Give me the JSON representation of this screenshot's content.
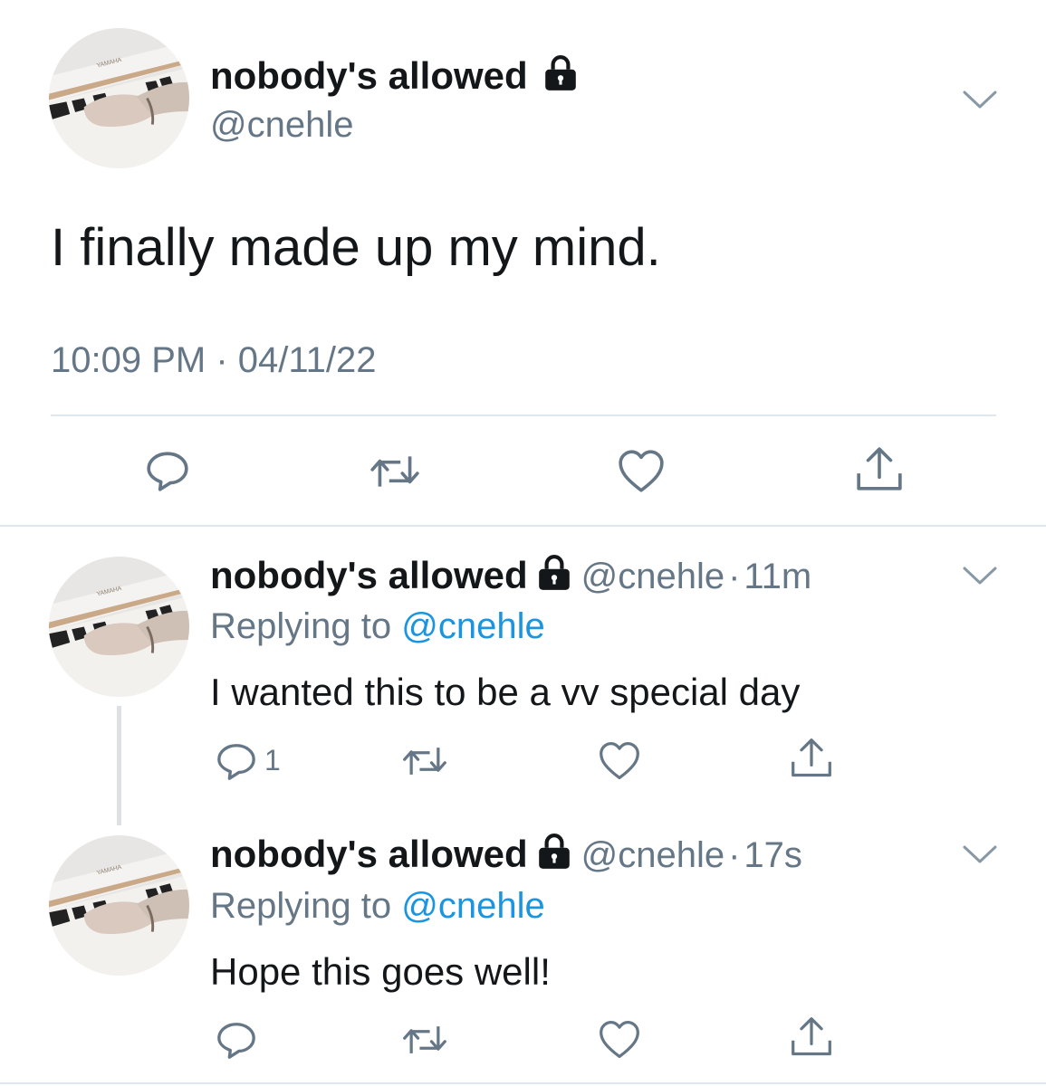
{
  "main_tweet": {
    "name": "nobody's allowed",
    "handle": "@cnehle",
    "text": "I finally made up my mind.",
    "timestamp": "10:09 PM · 04/11/22"
  },
  "replies": [
    {
      "name": "nobody's allowed",
      "handle": "@cnehle",
      "dot": "·",
      "time": "11m",
      "replying_prefix": "Replying to",
      "replying_handle": "@cnehle",
      "text": "I wanted this to be a vv special day",
      "reply_count": "1"
    },
    {
      "name": "nobody's allowed",
      "handle": "@cnehle",
      "dot": "·",
      "time": "17s",
      "replying_prefix": "Replying to",
      "replying_handle": "@cnehle",
      "text": "Hope this goes well!",
      "reply_count": ""
    }
  ],
  "icons": {
    "lock": "lock-icon",
    "chevron": "chevron-down-icon",
    "reply": "reply-icon",
    "retweet": "retweet-icon",
    "like": "heart-icon",
    "share": "share-icon"
  },
  "colors": {
    "text": "#14171a",
    "secondary": "#657786",
    "link": "#1b95e0",
    "divider": "#e1e8ed"
  }
}
